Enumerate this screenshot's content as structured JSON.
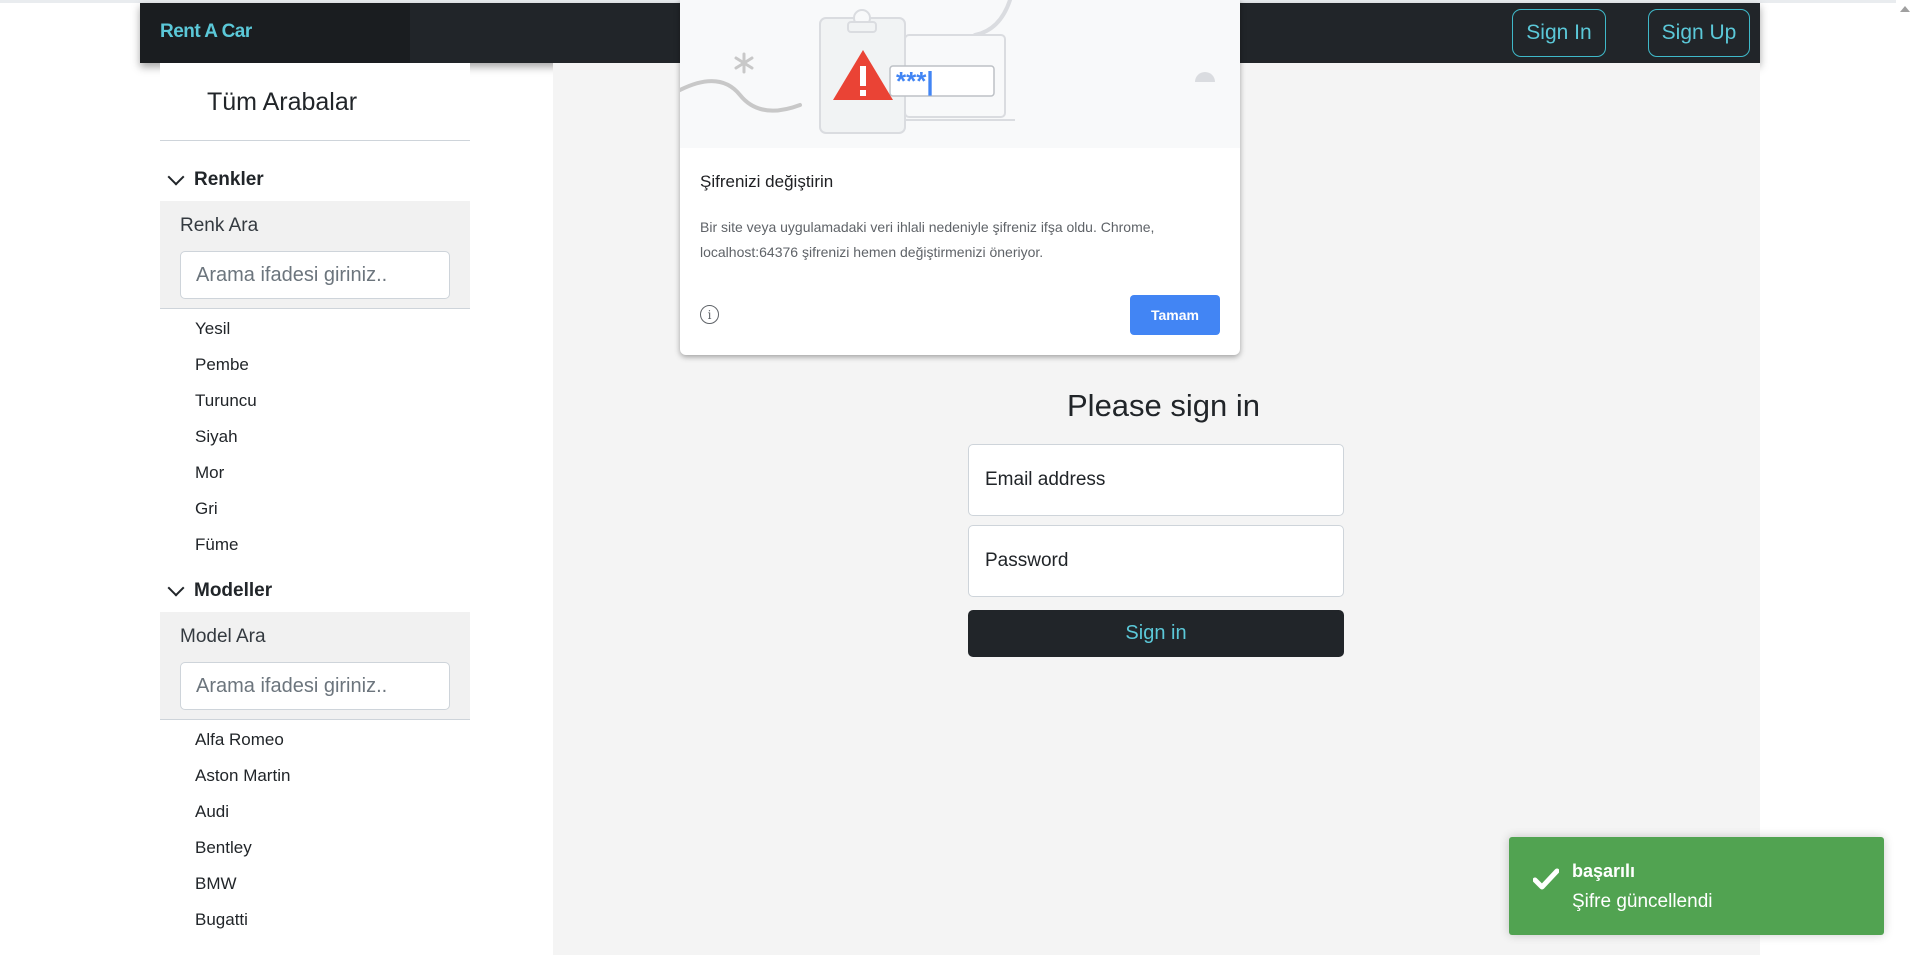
{
  "navbar": {
    "brand": "Rent A Car",
    "sign_in": "Sign In",
    "sign_up": "Sign Up"
  },
  "sidebar": {
    "title": "Tüm Arabalar",
    "colors_section": {
      "heading": "Renkler",
      "search_label": "Renk Ara",
      "search_placeholder": "Arama ifadesi giriniz..",
      "items": [
        "Yesil",
        "Pembe",
        "Turuncu",
        "Siyah",
        "Mor",
        "Gri",
        "Füme"
      ]
    },
    "models_section": {
      "heading": "Modeller",
      "search_label": "Model Ara",
      "search_placeholder": "Arama ifadesi giriniz..",
      "items": [
        "Alfa Romeo",
        "Aston Martin",
        "Audi",
        "Bentley",
        "BMW",
        "Bugatti"
      ]
    }
  },
  "login": {
    "title": "Please sign in",
    "email_placeholder": "Email address",
    "password_placeholder": "Password",
    "submit_label": "Sign in"
  },
  "password_popup": {
    "title": "Şifrenizi değiştirin",
    "message": "Bir site veya uygulamadaki veri ihlali nedeniyle şifreniz ifşa oldu. Chrome, localhost:64376 şifrenizi hemen değiştirmenizi öneriyor.",
    "masked_password": "***|",
    "ok_label": "Tamam",
    "icons": [
      "warning-icon",
      "info-icon"
    ]
  },
  "toast": {
    "title": "başarılı",
    "message": "Şifre güncellendi",
    "color": "#51a351"
  },
  "colors": {
    "navbar_bg": "#212529",
    "accent": "#5bc8d8",
    "chrome_blue": "#4285f4"
  }
}
